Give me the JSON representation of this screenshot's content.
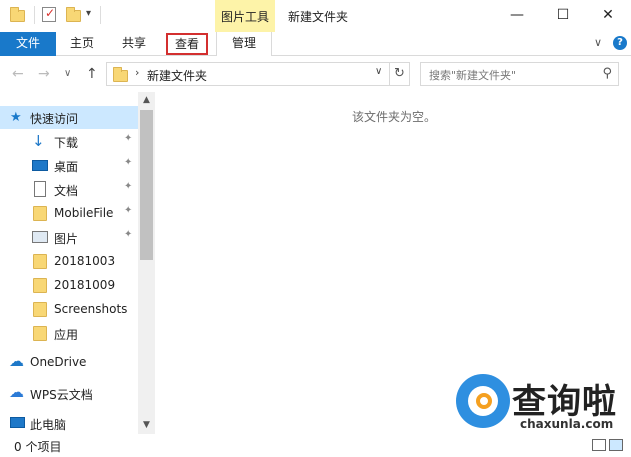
{
  "titlebar": {
    "title": "新建文件夹",
    "tool_tab_header": "图片工具",
    "minimize": "—",
    "maximize": "☐",
    "close": "✕"
  },
  "ribbon": {
    "tabs": [
      {
        "label": "文件"
      },
      {
        "label": "主页"
      },
      {
        "label": "共享"
      },
      {
        "label": "查看"
      },
      {
        "label": "管理"
      }
    ],
    "expand_label": "∨",
    "help_label": "?"
  },
  "address": {
    "path": "新建文件夹",
    "separator": "›",
    "dropdown": "∨",
    "refresh": "↻",
    "search_placeholder": "搜索\"新建文件夹\""
  },
  "nav": {
    "back": "←",
    "forward": "→",
    "recent": "∨",
    "up": "↑"
  },
  "navpane": {
    "items": [
      {
        "label": "快速访问",
        "icon": "star-icon"
      },
      {
        "label": "下载",
        "icon": "download-icon",
        "pinned": true
      },
      {
        "label": "桌面",
        "icon": "desktop-icon",
        "pinned": true
      },
      {
        "label": "文档",
        "icon": "document-icon",
        "pinned": true
      },
      {
        "label": "MobileFile",
        "icon": "folder-icon",
        "pinned": true
      },
      {
        "label": "图片",
        "icon": "pictures-icon",
        "pinned": true
      },
      {
        "label": "20181003",
        "icon": "folder-icon"
      },
      {
        "label": "20181009",
        "icon": "folder-icon"
      },
      {
        "label": "Screenshots",
        "icon": "folder-icon"
      },
      {
        "label": "应用",
        "icon": "folder-icon"
      },
      {
        "label": "OneDrive",
        "icon": "cloud-icon"
      },
      {
        "label": "WPS云文档",
        "icon": "wps-cloud-icon"
      },
      {
        "label": "此电脑",
        "icon": "computer-icon"
      }
    ],
    "pin_glyph": "📌"
  },
  "content": {
    "empty_message": "该文件夹为空。"
  },
  "statusbar": {
    "item_count": "0 个项目"
  },
  "watermark": {
    "text_cn": "查询啦",
    "text_en": "chaxunla.com"
  },
  "colors": {
    "accent": "#1979ca",
    "selected": "#cce8ff",
    "tool_tab": "#fdf3a8",
    "highlight_border": "#d32f2f"
  }
}
